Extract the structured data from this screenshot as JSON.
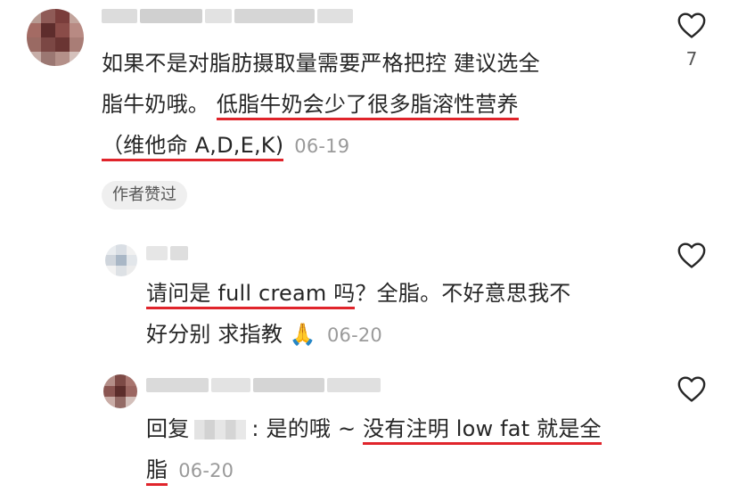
{
  "comments": [
    {
      "segments": {
        "line1": "如果不是对脂肪摄取量需要严格把控 建议选全",
        "line2_plain": "脂牛奶哦。 ",
        "line2_underlined": "低脂牛奶会少了很多脂溶性营养",
        "line3_underlined": "（维他命 A,D,E,K)"
      },
      "date": "06-19",
      "badge": "作者赞过",
      "like_count": "7"
    }
  ],
  "replies": [
    {
      "segments": {
        "line1_underlined": "请问是 full cream 吗",
        "line1_rest": "？全脂。不好意思我不",
        "line2": "好分别 求指教 ",
        "emoji": "🙏"
      },
      "date": "06-20"
    },
    {
      "segments": {
        "reply_prefix": "回复",
        "reply_rest": ": 是的哦 ~ ",
        "line1_underlined": "没有注明 low fat 就是全",
        "line2_underlined": "脂"
      },
      "date": "06-20"
    }
  ],
  "icons": {
    "like": "heart-outline-icon"
  },
  "colors": {
    "underline": "#e0242b",
    "date": "#9a9a9a"
  }
}
